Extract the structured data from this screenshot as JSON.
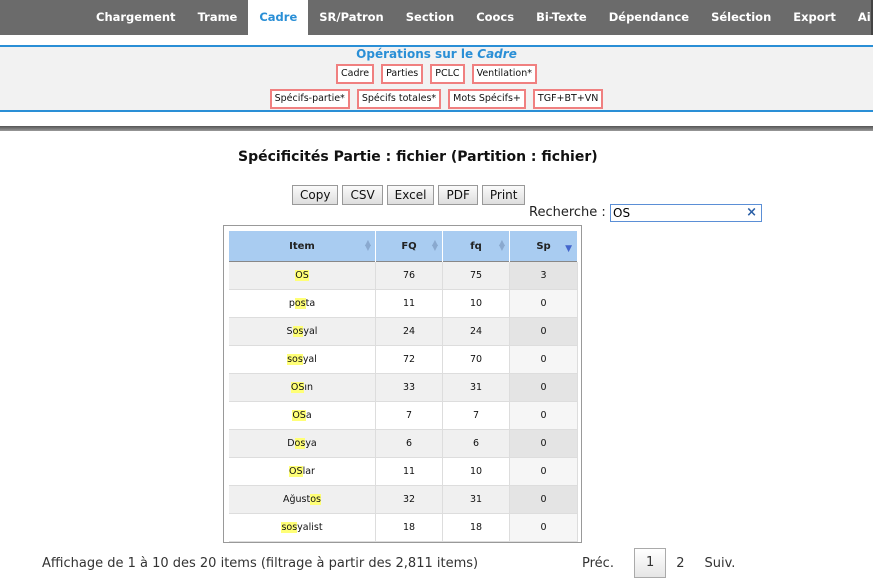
{
  "nav": {
    "tabs": [
      "Chargement",
      "Trame",
      "Cadre",
      "SR/Patron",
      "Section",
      "Coocs",
      "Bi-Texte",
      "Dépendance",
      "Sélection",
      "Export",
      "Aide"
    ],
    "active": "Cadre"
  },
  "operations": {
    "title_prefix": "Opérations sur le",
    "title_em": "Cadre",
    "row1": [
      "Cadre",
      "Parties",
      "PCLC",
      "Ventilation*"
    ],
    "row2": [
      "Spécifs-partie*",
      "Spécifs totales*",
      "Mots Spécifs+",
      "TGF+BT+VN"
    ]
  },
  "page_title": "Spécificités Partie : fichier (Partition : fichier)",
  "export_buttons": [
    "Copy",
    "CSV",
    "Excel",
    "PDF",
    "Print"
  ],
  "search": {
    "label": "Recherche :",
    "value": "OS",
    "clear": "×"
  },
  "table": {
    "headers": [
      "Item",
      "FQ",
      "fq",
      "Sp"
    ],
    "rows": [
      {
        "pre": "",
        "hl": "OS",
        "post": "",
        "FQ": "76",
        "fq": "75",
        "Sp": "3"
      },
      {
        "pre": "p",
        "hl": "os",
        "post": "ta",
        "FQ": "11",
        "fq": "10",
        "Sp": "0"
      },
      {
        "pre": "S",
        "hl": "os",
        "post": "yal",
        "FQ": "24",
        "fq": "24",
        "Sp": "0"
      },
      {
        "pre": "",
        "hl": "sos",
        "post": "yal",
        "FQ": "72",
        "fq": "70",
        "Sp": "0"
      },
      {
        "pre": "",
        "hl": "OS",
        "post": "ın",
        "FQ": "33",
        "fq": "31",
        "Sp": "0"
      },
      {
        "pre": "",
        "hl": "OS",
        "post": "a",
        "FQ": "7",
        "fq": "7",
        "Sp": "0"
      },
      {
        "pre": "D",
        "hl": "os",
        "post": "ya",
        "FQ": "6",
        "fq": "6",
        "Sp": "0"
      },
      {
        "pre": "",
        "hl": "OS",
        "post": "lar",
        "FQ": "11",
        "fq": "10",
        "Sp": "0"
      },
      {
        "pre": "Ağust",
        "hl": "os",
        "post": "",
        "FQ": "32",
        "fq": "31",
        "Sp": "0"
      },
      {
        "pre": "",
        "hl": "sos",
        "post": "yalist",
        "FQ": "18",
        "fq": "18",
        "Sp": "0"
      }
    ]
  },
  "footer": {
    "info": "Affichage de 1 à 10 des 20 items (filtrage à partir des 2,811 items)",
    "prev": "Préc.",
    "pages": [
      "1",
      "2"
    ],
    "next": "Suiv."
  }
}
